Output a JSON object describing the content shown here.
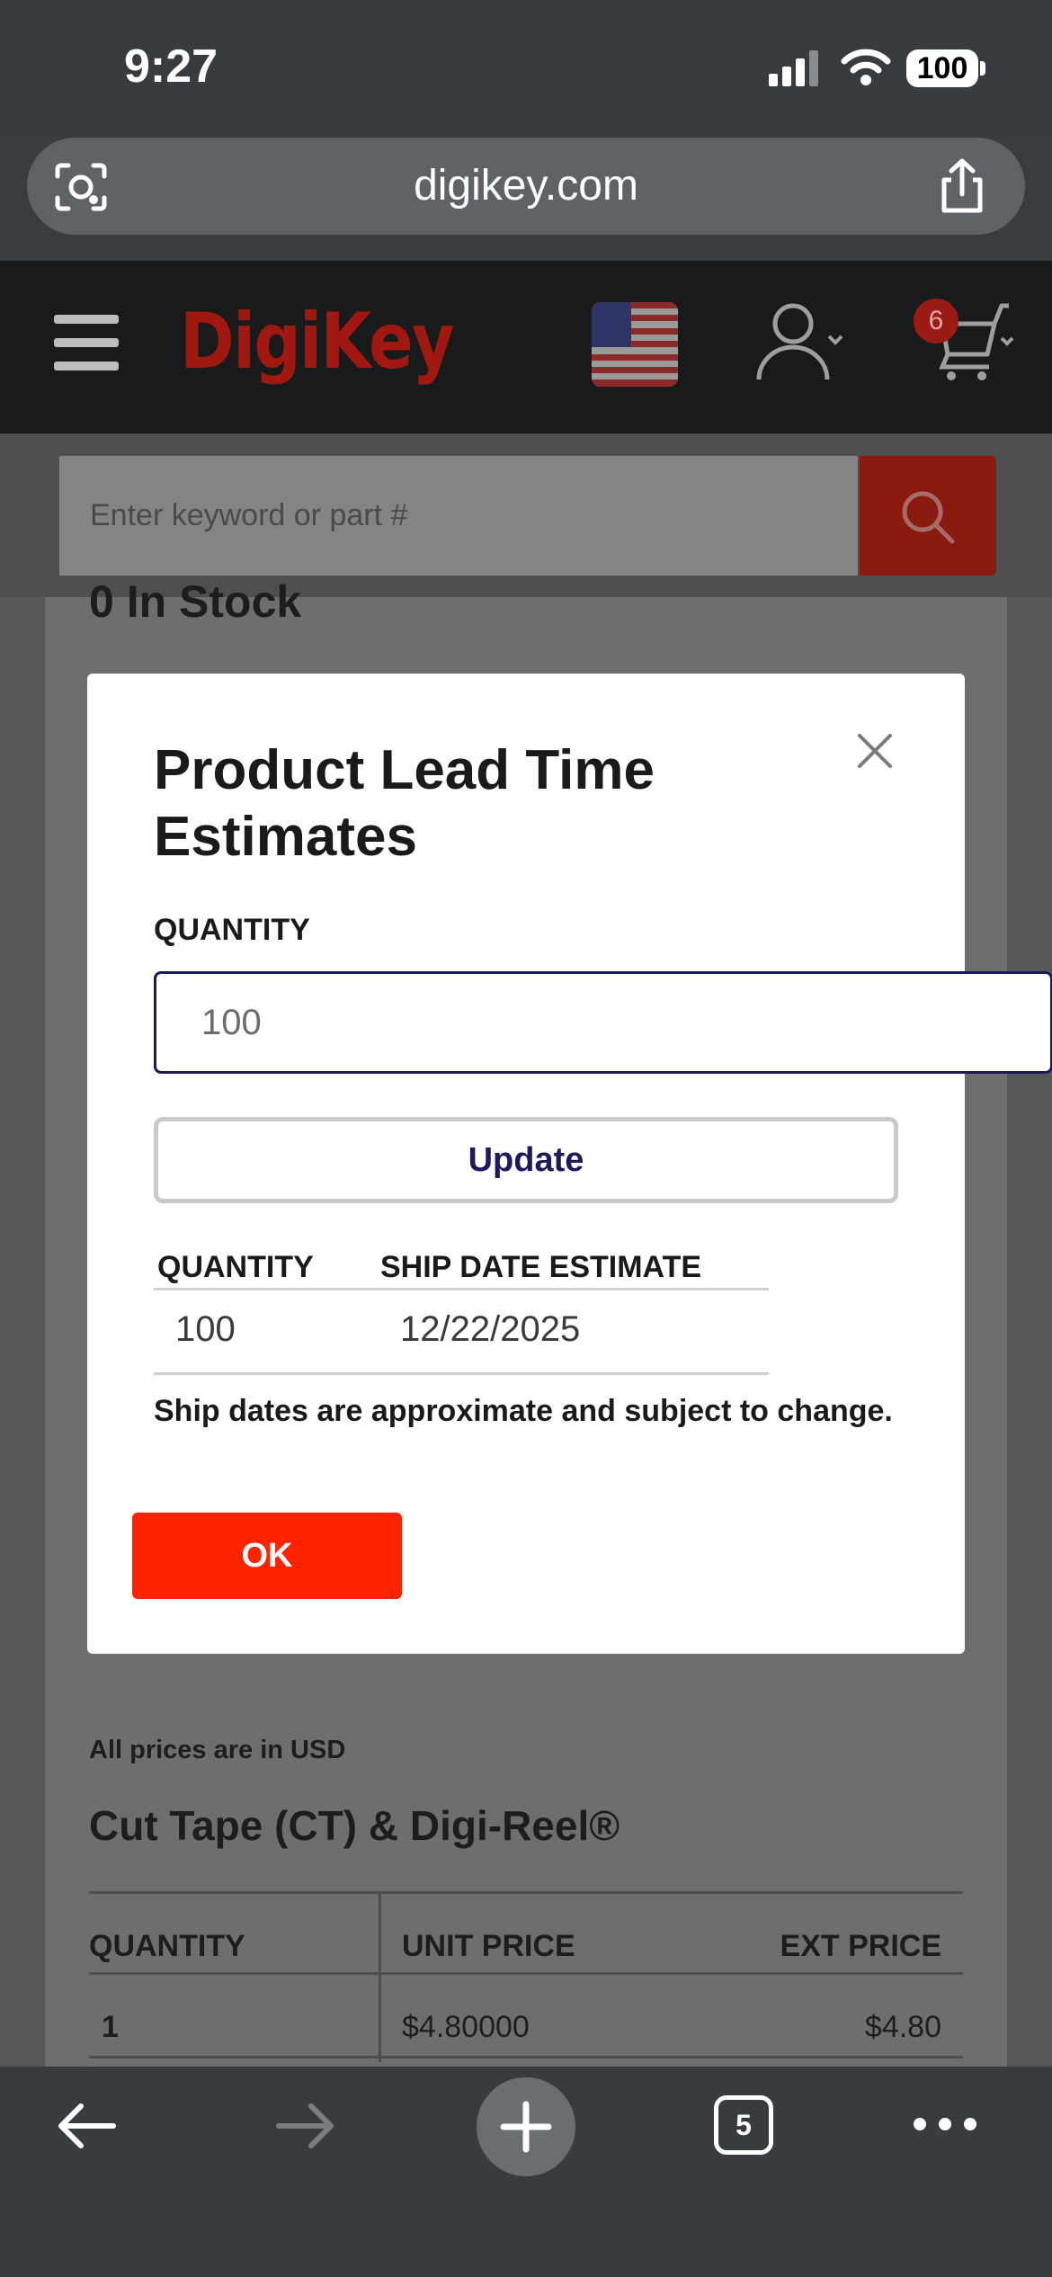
{
  "status_bar": {
    "time": "9:27",
    "battery": "100"
  },
  "browser": {
    "url": "digikey.com",
    "open_tabs": "5"
  },
  "header": {
    "logo": "DigiKey",
    "cart_count": "6"
  },
  "search": {
    "placeholder": "Enter keyword or part #"
  },
  "page": {
    "stock_title": "0 In Stock",
    "prices_note": "All prices are in USD",
    "packaging_title": "Cut Tape (CT) & Digi-Reel®",
    "price_table": {
      "headers": [
        "QUANTITY",
        "UNIT PRICE",
        "EXT PRICE"
      ],
      "rows": [
        {
          "quantity": "1",
          "unit_price": "$4.80000",
          "ext_price": "$4.80"
        }
      ]
    }
  },
  "modal": {
    "title": "Product Lead Time Estimates",
    "quantity_label": "QUANTITY",
    "quantity_value": "100",
    "update_label": "Update",
    "table": {
      "headers": [
        "QUANTITY",
        "SHIP DATE ESTIMATE"
      ],
      "rows": [
        {
          "quantity": "100",
          "ship_date": "12/22/2025"
        }
      ]
    },
    "disclaimer": "Ship dates are approximate and subject to change.",
    "ok_label": "OK"
  },
  "colors": {
    "brand_red": "#ff2200",
    "dark_navy": "#1c1a5a"
  },
  "icons": [
    "camera-search-icon",
    "share-icon",
    "menu-icon",
    "flag-icon",
    "account-icon",
    "cart-icon",
    "search-icon",
    "close-icon",
    "back-icon",
    "forward-icon",
    "plus-icon",
    "tabs-icon",
    "more-icon"
  ]
}
